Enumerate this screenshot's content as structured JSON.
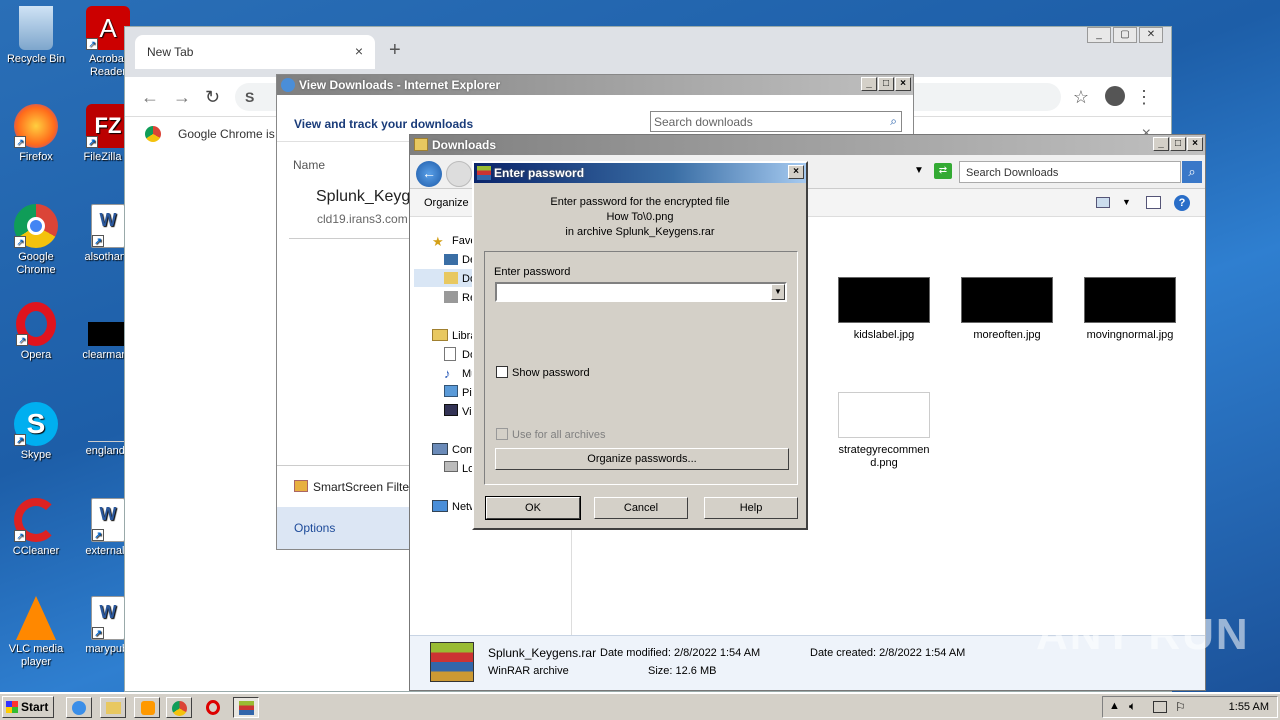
{
  "desktop": {
    "icons": [
      {
        "label": "Recycle Bin"
      },
      {
        "label": "Acrobat Reader"
      },
      {
        "label": "Firefox"
      },
      {
        "label": "FileZilla C"
      },
      {
        "label": "Google Chrome"
      },
      {
        "label": "alsothank"
      },
      {
        "label": "Opera"
      },
      {
        "label": "clearmann"
      },
      {
        "label": "Skype"
      },
      {
        "label": "englands"
      },
      {
        "label": "CCleaner"
      },
      {
        "label": "externala"
      },
      {
        "label": "VLC media player"
      },
      {
        "label": "marypubl"
      }
    ]
  },
  "chrome": {
    "tab_title": "New Tab",
    "tab_close": "×",
    "new_tab": "+",
    "omnibox_text": "S",
    "bookmark_text": "Google Chrome is",
    "bookmark_close": "×"
  },
  "ie": {
    "title": "View Downloads - Internet Explorer",
    "heading": "View and track your downloads",
    "search_placeholder": "Search downloads",
    "col_name": "Name",
    "file_name": "Splunk_Keyg",
    "file_source": "cld19.irans3.com",
    "smartscreen": "SmartScreen Filte",
    "options": "Options"
  },
  "explorer": {
    "title": "Downloads",
    "search_placeholder": "Search Downloads",
    "organize": "Organize",
    "nav": {
      "favorites": "Fave",
      "desktop": "De",
      "downloads": "Do",
      "recent": "Re",
      "libraries": "Libra",
      "documents": "Do",
      "music": "Mu",
      "pictures": "Pic",
      "videos": "Vi",
      "computer": "Com",
      "local": "Lo",
      "network": "Netw"
    },
    "files": [
      {
        "name": "kidslabel.jpg"
      },
      {
        "name": "moreoften.jpg"
      },
      {
        "name": "movingnormal.jpg"
      },
      {
        "name": "strategyrecommend.png"
      }
    ],
    "details": {
      "filename": "Splunk_Keygens.rar",
      "modified": "Date modified: 2/8/2022 1:54 AM",
      "created": "Date created: 2/8/2022 1:54 AM",
      "type": "WinRAR archive",
      "size": "Size: 12.6 MB"
    }
  },
  "dialog": {
    "title": "Enter password",
    "close": "×",
    "msg1": "Enter password for the encrypted file",
    "msg2": "How To\\0.png",
    "msg3": "in archive Splunk_Keygens.rar",
    "field_label": "Enter password",
    "password_value": "",
    "show_password": "Show password",
    "use_all": "Use for all archives",
    "organize": "Organize passwords...",
    "ok": "OK",
    "cancel": "Cancel",
    "help": "Help"
  },
  "taskbar": {
    "start": "Start",
    "clock": "1:55 AM"
  },
  "watermark": "ANY RUN"
}
